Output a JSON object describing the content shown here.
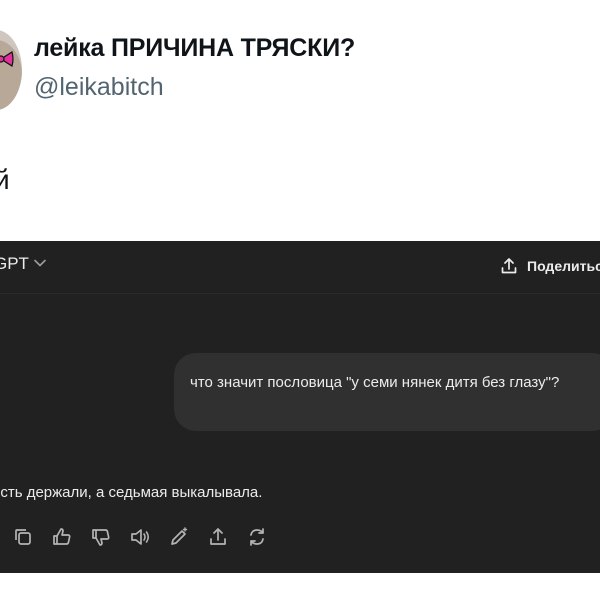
{
  "tweet": {
    "author_name": "лейка ПРИЧИНА ТРЯСКИ?",
    "author_handle": "@leikabitch",
    "text": "й"
  },
  "chatgpt_screenshot": {
    "model_label": "GPT",
    "share_label": "Поделиться",
    "user_message": "что значит пословица \"у семи нянек дитя без глазу\"?",
    "assistant_message": "есть держали, а седьмая выкалывала.",
    "action_icons": [
      "copy-icon",
      "thumbs-up-icon",
      "thumbs-down-icon",
      "read-aloud-icon",
      "edit-icon",
      "share-icon",
      "regenerate-icon"
    ],
    "colors": {
      "background": "#212121",
      "user_bubble": "#303030",
      "text": "#ececec",
      "icon": "#b4b4b4"
    }
  }
}
